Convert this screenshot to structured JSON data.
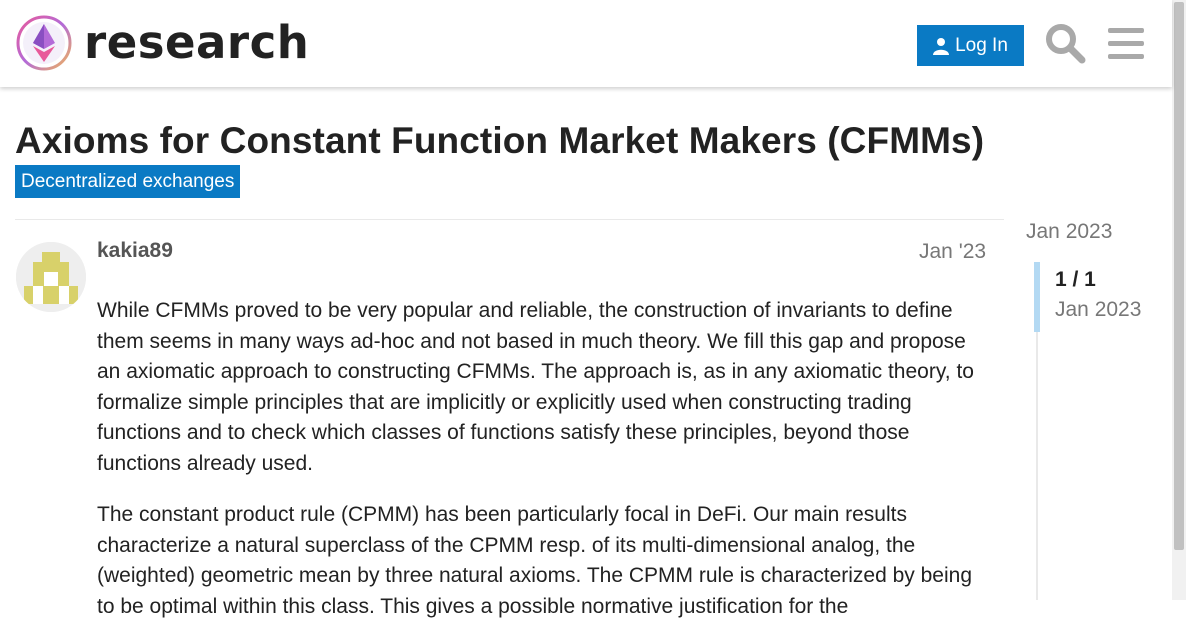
{
  "header": {
    "site_name": "research",
    "login_label": "Log In"
  },
  "topic": {
    "title": "Axioms for Constant Function Market Makers (CFMMs)",
    "category": "Decentralized exchanges"
  },
  "post": {
    "username": "kakia89",
    "date": "Jan '23",
    "paragraphs": [
      "While CFMMs proved to be very popular and reliable, the construction of invariants to define them seems in many ways ad-hoc and not based in much theory. We fill this gap and propose an axiomatic approach to constructing CFMMs. The approach is, as in any axiomatic theory, to formalize simple principles that are implicitly or explicitly used when constructing trading functions and to check which classes of functions satisfy these principles, beyond those functions already used.",
      "The constant product rule (CPMM) has been particularly focal in DeFi. Our main results characterize a natural superclass of the CPMM resp. of its multi-dimensional analog, the (weighted) geometric mean by three natural axioms. The CPMM rule is characterized by being to be optimal within this class. This gives a possible normative justification for the"
    ]
  },
  "timeline": {
    "start_date": "Jan 2023",
    "count": "1 / 1",
    "current_date": "Jan 2023"
  },
  "colors": {
    "accent": "#0a7ac4",
    "timeline_handle": "#b3d9f3",
    "avatar_fg": "#d8d16a"
  },
  "icons": {
    "logo": "ethereum-research-logo",
    "user": "user-icon",
    "search": "search-icon",
    "menu": "hamburger-menu-icon"
  }
}
